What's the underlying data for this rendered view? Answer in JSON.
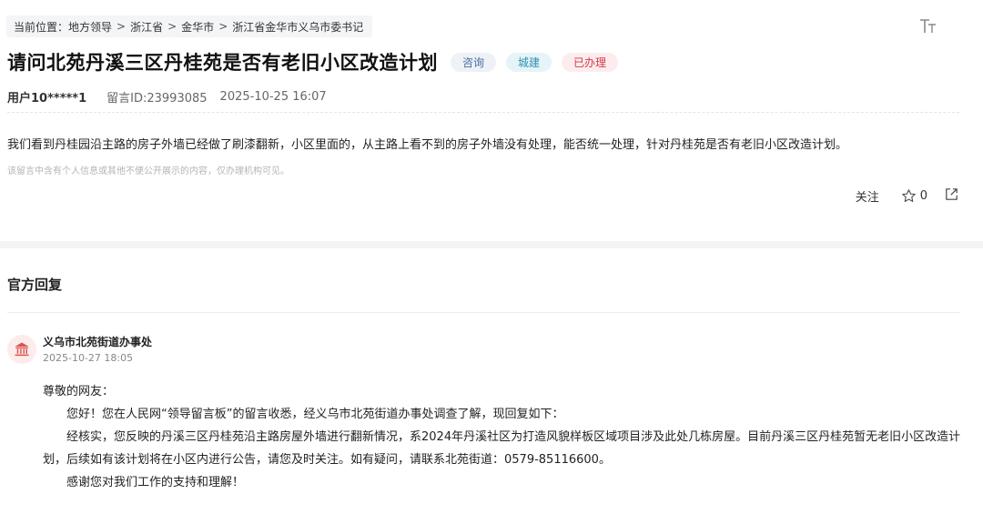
{
  "breadcrumb": {
    "prefix": "当前位置：",
    "items": [
      "地方领导",
      "浙江省",
      "金华市",
      "浙江省金华市义乌市委书记"
    ],
    "separator": ">"
  },
  "header": {
    "font_size_icon": "text-size-icon",
    "title": "请问北苑丹溪三区丹桂苑是否有老旧小区改造计划",
    "tags": [
      "咨询",
      "城建",
      "已办理"
    ]
  },
  "meta": {
    "user": "用户10*****1",
    "message_id": "留言ID:23993085",
    "time": "2025-10-25 16:07"
  },
  "message": {
    "content": "我们看到丹桂园沿主路的房子外墙已经做了刷漆翻新，小区里面的，从主路上看不到的房子外墙没有处理，能否统一处理，针对丹桂苑是否有老旧小区改造计划。",
    "privacy_note": "该留言中含有个人信息或其他不便公开展示的内容，仅办理机构可见。"
  },
  "actions": {
    "follow": "关注",
    "star_count": "0",
    "star_icon": "star-icon",
    "share_icon": "share-icon"
  },
  "reply": {
    "section_title": "官方回复",
    "org_icon": "government-building-icon",
    "org_name": "义乌市北苑街道办事处",
    "time": "2025-10-27 18:05",
    "greeting": "尊敬的网友：",
    "p1": "您好！您在人民网“领导留言板”的留言收悉，经义乌市北苑街道办事处调查了解，现回复如下：",
    "p2": "经核实，您反映的丹溪三区丹桂苑沿主路房屋外墙进行翻新情况，系2024年丹溪社区为打造风貌样板区域项目涉及此处几栋房屋。目前丹溪三区丹桂苑暂无老旧小区改造计划，后续如有该计划将在小区内进行公告，请您及时关注。如有疑问，请联系北苑街道：0579-85116600。",
    "p3": "感谢您对我们工作的支持和理解！"
  },
  "colors": {
    "tag_consult_bg": "#eef1f6",
    "tag_urban_bg": "#e6f4f8",
    "tag_done_bg": "#fdecee",
    "tag_done_text": "#d33a46",
    "org_icon_color": "#d9534f"
  }
}
